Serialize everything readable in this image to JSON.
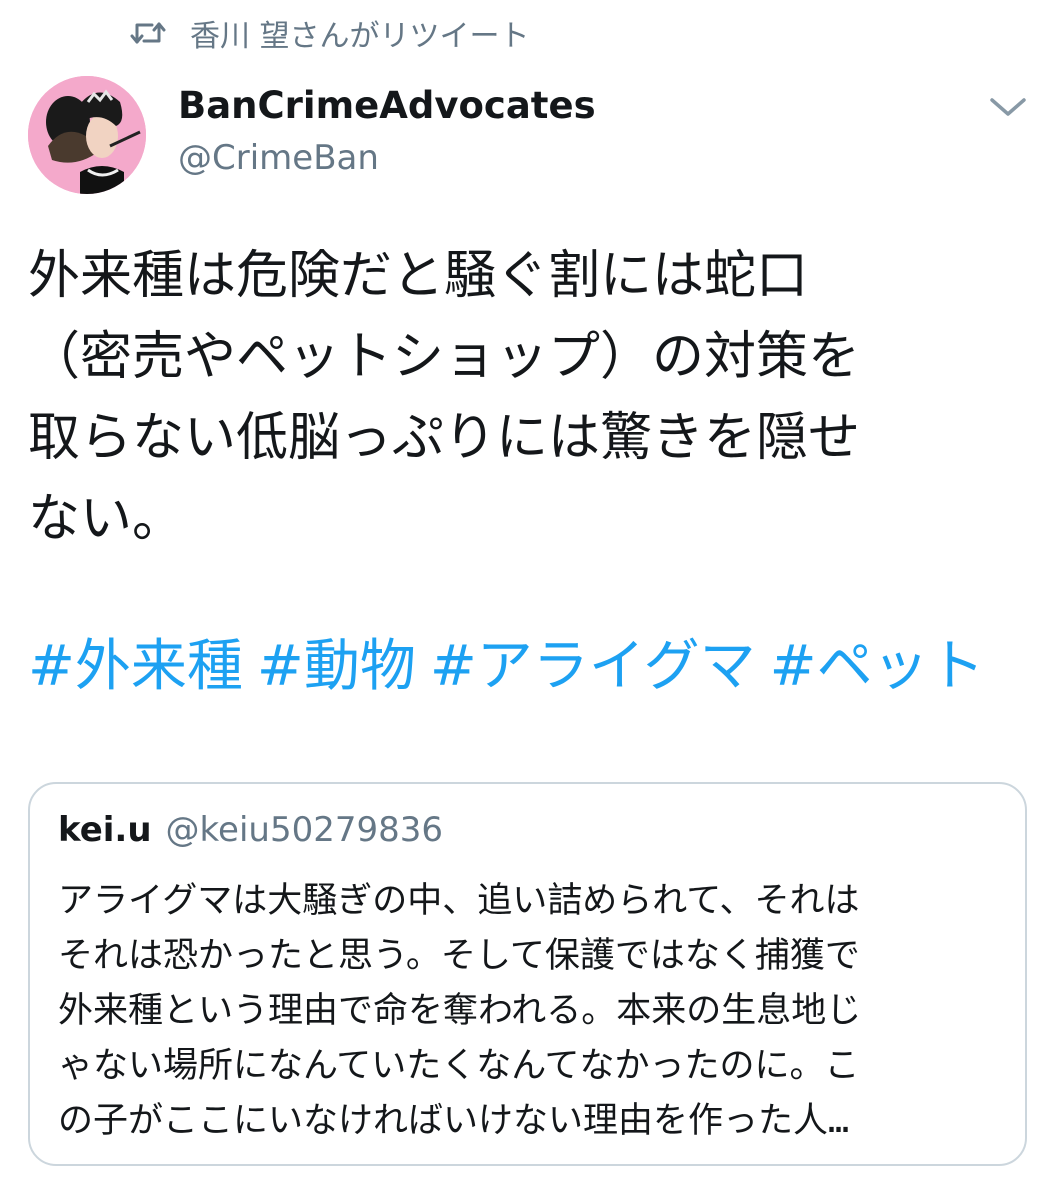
{
  "retweet": {
    "text": "香川 望さんがリツイート",
    "icon": "retweet-icon"
  },
  "tweet": {
    "author_name": "BanCrimeAdvocates",
    "author_handle": "@CrimeBan",
    "menu_icon": "chevron-down-icon",
    "body": "外来種は危険だと騒ぐ割には蛇口\n（密売やペットショップ）の対策を\n取らない低脳っぷりには驚きを隠せ\nない。",
    "hashtags": [
      "#外来種",
      "#動物",
      "#アライグマ",
      "#ペット"
    ]
  },
  "quote": {
    "author_name": "kei.u",
    "author_handle": "@keiu50279836",
    "text": "アライグマは大騒ぎの中、追い詰められて、それは\nそれは恐かったと思う。そして保護ではなく捕獲で\n外来種という理由で命を奪われる。本来の生息地じ\nゃない場所になんていたくなんてなかったのに。こ\nの子がここにいなければいけない理由を作った人…"
  },
  "colors": {
    "link": "#1da1f2",
    "secondary_text": "#657786",
    "border": "#ccd6dd",
    "avatar_bg": "#f2a6c8"
  }
}
